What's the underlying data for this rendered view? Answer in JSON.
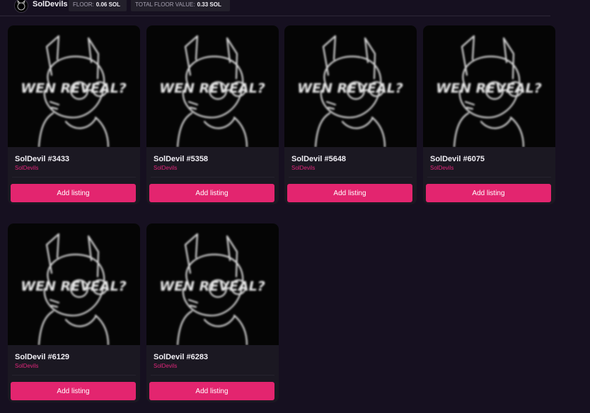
{
  "collection": {
    "name": "SolDevils",
    "floor_label": "FLOOR:",
    "floor_value": "0.06 SOL",
    "total_floor_label": "TOTAL FLOOR VALUE:",
    "total_floor_value": "0.33 SOL",
    "avatar_icon": "devil-avatar-icon"
  },
  "image_text": "WEN REVEAL?",
  "cards": [
    {
      "title": "SolDevil #3433",
      "collection": "SolDevils",
      "button": "Add listing"
    },
    {
      "title": "SolDevil #5358",
      "collection": "SolDevils",
      "button": "Add listing"
    },
    {
      "title": "SolDevil #5648",
      "collection": "SolDevils",
      "button": "Add listing"
    },
    {
      "title": "SolDevil #6075",
      "collection": "SolDevils",
      "button": "Add listing"
    },
    {
      "title": "SolDevil #6129",
      "collection": "SolDevils",
      "button": "Add listing"
    },
    {
      "title": "SolDevil #6283",
      "collection": "SolDevils",
      "button": "Add listing"
    }
  ],
  "colors": {
    "accent": "#e3256f",
    "background": "#161020",
    "card": "#1b1822"
  }
}
